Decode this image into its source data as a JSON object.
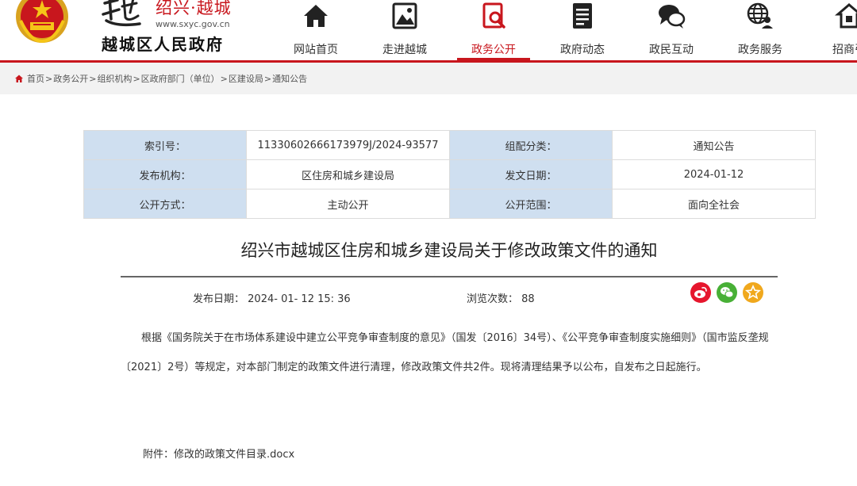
{
  "header": {
    "logo_red_text": "绍兴·越城",
    "logo_url": "www.sxyc.gov.cn",
    "logo_name": "越城区人民政府",
    "nav": [
      {
        "label": "网站首页",
        "icon": "home-icon"
      },
      {
        "label": "走进越城",
        "icon": "picture-icon"
      },
      {
        "label": "政务公开",
        "icon": "document-search-icon",
        "active": true
      },
      {
        "label": "政府动态",
        "icon": "news-list-icon"
      },
      {
        "label": "政民互动",
        "icon": "chat-bubbles-icon"
      },
      {
        "label": "政务服务",
        "icon": "globe-service-icon"
      },
      {
        "label": "招商引",
        "icon": "investment-icon"
      }
    ]
  },
  "breadcrumb": [
    "首页",
    "政务公开",
    "组织机构",
    "区政府部门（单位）",
    "区建设局",
    "通知公告"
  ],
  "info": {
    "rows": [
      [
        {
          "k": "索引号：",
          "v": "11330602666173979J/2024-93577"
        },
        {
          "k": "组配分类：",
          "v": "通知公告"
        }
      ],
      [
        {
          "k": "发布机构：",
          "v": "区住房和城乡建设局"
        },
        {
          "k": "发文日期：",
          "v": "2024-01-12"
        }
      ],
      [
        {
          "k": "公开方式：",
          "v": "主动公开"
        },
        {
          "k": "公开范围：",
          "v": "面向全社会"
        }
      ]
    ]
  },
  "article": {
    "title": "绍兴市越城区住房和城乡建设局关于修改政策文件的通知",
    "publish_label": "发布日期：",
    "publish_date": "2024- 01- 12 15: 36",
    "views_label": "浏览次数：",
    "views": "88",
    "body": "根据《国务院关于在市场体系建设中建立公平竞争审查制度的意见》（国发〔2016〕34号）、《公平竞争审查制度实施细则》（国市监反垄规〔2021〕2号）等规定，对本部门制定的政策文件进行清理，修改政策文件共2件。现将清理结果予以公布，自发布之日起施行。",
    "attachment_label": "附件：",
    "attachment_name": "修改的政策文件目录.docx"
  },
  "colors": {
    "brand_red": "#c8161d",
    "table_key_bg": "#cfdff0",
    "weibo": "#e6162d",
    "wechat": "#48b036",
    "favorite": "#f0a81d"
  }
}
